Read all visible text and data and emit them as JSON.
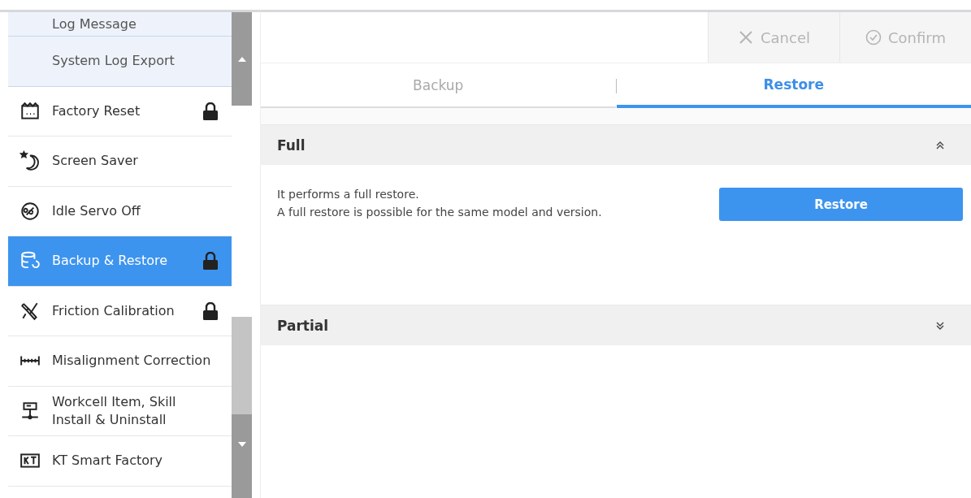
{
  "sidebar": {
    "items": [
      {
        "kind": "sub",
        "label": "Log Message",
        "locked": false,
        "selected": false
      },
      {
        "kind": "sub",
        "label": "System Log Export",
        "locked": false,
        "selected": false
      },
      {
        "kind": "item",
        "label": "Factory Reset",
        "locked": true,
        "selected": false
      },
      {
        "kind": "item",
        "label": "Screen Saver",
        "locked": false,
        "selected": false
      },
      {
        "kind": "item",
        "label": "Idle Servo Off",
        "locked": false,
        "selected": false
      },
      {
        "kind": "item",
        "label": "Backup & Restore",
        "locked": true,
        "selected": true
      },
      {
        "kind": "item",
        "label": "Friction Calibration",
        "locked": true,
        "selected": false
      },
      {
        "kind": "item",
        "label": "Misalignment Correction",
        "locked": false,
        "selected": false
      },
      {
        "kind": "item",
        "label": "Workcell Item, Skill Install & Uninstall",
        "locked": false,
        "selected": false
      },
      {
        "kind": "item",
        "label": "KT Smart Factory",
        "locked": false,
        "selected": false
      }
    ]
  },
  "toolbar": {
    "buttons": [
      {
        "label": "Cancel",
        "disabled": true
      },
      {
        "label": "Confirm",
        "disabled": true
      }
    ]
  },
  "tabs": [
    {
      "label": "Backup",
      "selected": false
    },
    {
      "label": "Restore",
      "selected": true
    }
  ],
  "sections": [
    {
      "title": "Full",
      "expanded": true,
      "lines": [
        "It performs a full restore.",
        "A full restore is possible for the same model and version."
      ],
      "button": "Restore"
    },
    {
      "title": "Partial",
      "expanded": false
    }
  ]
}
